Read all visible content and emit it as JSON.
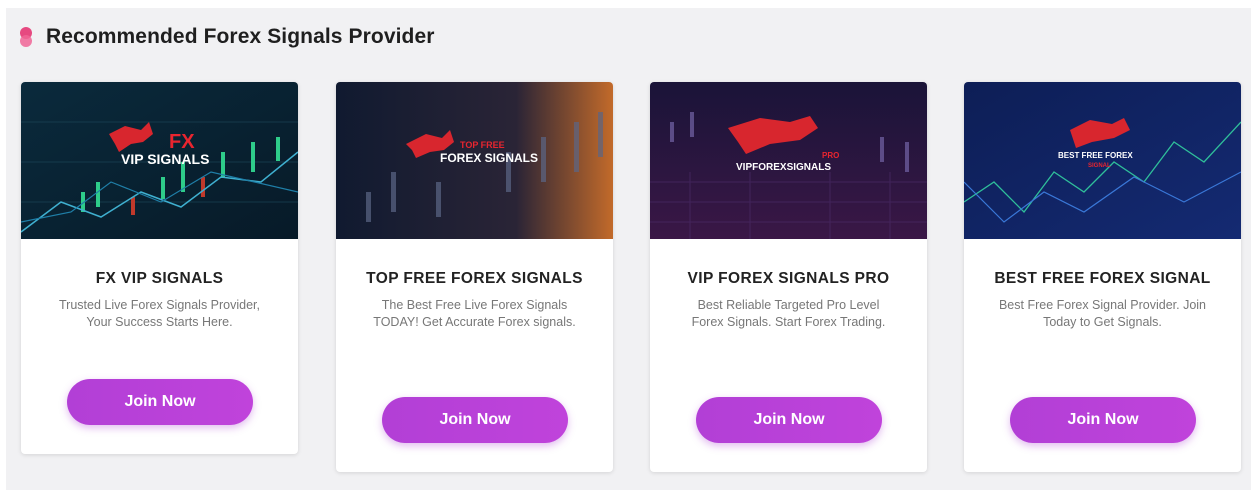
{
  "section": {
    "title": "Recommended Forex Signals Provider",
    "icon": "dots-icon",
    "accent": "#e64980"
  },
  "button_color": "#b83fd8",
  "cards": [
    {
      "title": "FX VIP SIGNALS",
      "description": "Trusted Live Forex Signals Provider, Your Success Starts Here.",
      "button": "Join Now",
      "logo": {
        "line1": "FX",
        "line2": "VIP SIGNALS"
      }
    },
    {
      "title": "TOP FREE FOREX SIGNALS",
      "description": "The Best Free Live Forex Signals TODAY! Get Accurate Forex signals.",
      "button": "Join Now",
      "logo": {
        "line1": "TOP FREE",
        "line2": "FOREX SIGNALS"
      }
    },
    {
      "title": "VIP FOREX SIGNALS PRO",
      "description": "Best Reliable Targeted Pro Level Forex Signals. Start Forex Trading.",
      "button": "Join Now",
      "logo": {
        "line1": "PRO",
        "line2": "VIPFOREXSIGNALS"
      }
    },
    {
      "title": "BEST FREE FOREX SIGNAL",
      "description": "Best Free Forex Signal Provider. Join Today to Get Signals.",
      "button": "Join Now",
      "logo": {
        "line1": "BEST FREE FOREX",
        "line2": "SIGNAL"
      }
    }
  ]
}
